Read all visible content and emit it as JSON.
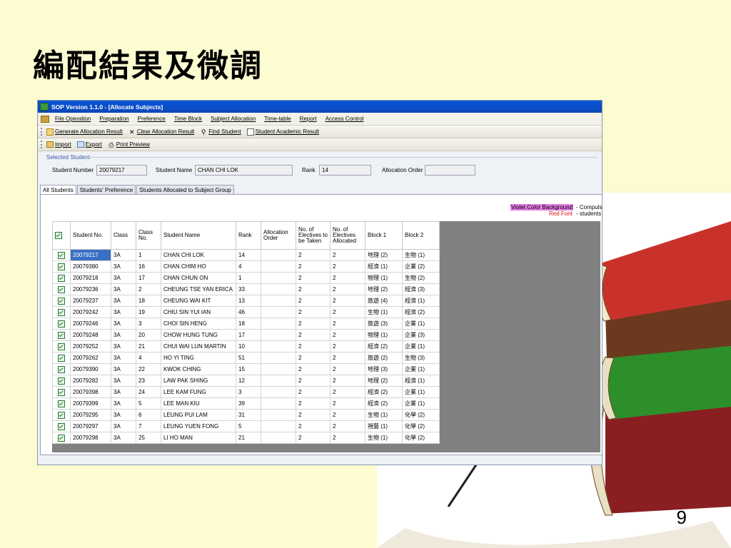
{
  "slide": {
    "title": "編配結果及微調",
    "page_number": "9"
  },
  "window": {
    "title": "SOP Version 1.1.0 - [Allocate Subjects]"
  },
  "menu": [
    "File Operation",
    "Preparation",
    "Preference",
    "Time Block",
    "Subject Allocation",
    "Time-table",
    "Report",
    "Access Control"
  ],
  "toolbar1": {
    "generate": "Generate Allocation Result",
    "clear": "Clear Allocation Result",
    "find": "Find Student",
    "academic": "Student Academic Result"
  },
  "toolbar2": {
    "import": "Import",
    "export": "Export",
    "print": "Print Preview"
  },
  "selected_student": {
    "legend": "Selected Student",
    "student_number_label": "Student Number",
    "student_number": "20079217",
    "student_name_label": "Student Name",
    "student_name": "CHAN CHI LOK",
    "rank_label": "Rank",
    "rank": "14",
    "allocation_order_label": "Allocation Order",
    "allocation_order": ""
  },
  "tabs": [
    "All Students",
    "Students' Preference",
    "Students Allocated to Subject Group"
  ],
  "legend": {
    "violet": "Violet Color Background",
    "violet_desc": "- Compulso",
    "red": "Red Font",
    "red_desc": "- students w"
  },
  "columns": [
    "Student No.",
    "Class",
    "Class No.",
    "Student Name",
    "Rank",
    "Allocation Order",
    "No. of Electives to be Taken",
    "No. of Electives Allocated",
    "Block 1",
    "Block 2"
  ],
  "rows": [
    {
      "no": "20079217",
      "cls": "3A",
      "cno": "1",
      "name": "CHAN CHI LOK",
      "rank": "14",
      "order": "",
      "taken": "2",
      "alloc": "2",
      "b1": "地理 (2)",
      "b2": "生物 (1)"
    },
    {
      "no": "20079380",
      "cls": "3A",
      "cno": "16",
      "name": "CHAN CHIM HO",
      "rank": "4",
      "order": "",
      "taken": "2",
      "alloc": "2",
      "b1": "經濟 (1)",
      "b2": "企業 (2)"
    },
    {
      "no": "20079218",
      "cls": "3A",
      "cno": "17",
      "name": "CHAN CHUN ON",
      "rank": "1",
      "order": "",
      "taken": "2",
      "alloc": "2",
      "b1": "物理 (1)",
      "b2": "生物 (2)"
    },
    {
      "no": "20079236",
      "cls": "3A",
      "cno": "2",
      "name": "CHEUNG TSE YAN ERICA",
      "rank": "33",
      "order": "",
      "taken": "2",
      "alloc": "2",
      "b1": "地理 (2)",
      "b2": "經濟 (3)"
    },
    {
      "no": "20079237",
      "cls": "3A",
      "cno": "18",
      "name": "CHEUNG WAI KIT",
      "rank": "13",
      "order": "",
      "taken": "2",
      "alloc": "2",
      "b1": "旅遊 (4)",
      "b2": "經濟 (1)"
    },
    {
      "no": "20079242",
      "cls": "3A",
      "cno": "19",
      "name": "CHIU SIN YUI IAN",
      "rank": "46",
      "order": "",
      "taken": "2",
      "alloc": "2",
      "b1": "生物 (1)",
      "b2": "經濟 (2)"
    },
    {
      "no": "20079246",
      "cls": "3A",
      "cno": "3",
      "name": "CHOI SIN HENG",
      "rank": "18",
      "order": "",
      "taken": "2",
      "alloc": "2",
      "b1": "旅遊 (3)",
      "b2": "企業 (1)"
    },
    {
      "no": "20079248",
      "cls": "3A",
      "cno": "20",
      "name": "CHOW HUNG TUNG",
      "rank": "17",
      "order": "",
      "taken": "2",
      "alloc": "2",
      "b1": "物理 (1)",
      "b2": "企業 (3)"
    },
    {
      "no": "20079252",
      "cls": "3A",
      "cno": "21",
      "name": "CHUI WAI LUN MARTIN",
      "rank": "10",
      "order": "",
      "taken": "2",
      "alloc": "2",
      "b1": "經濟 (2)",
      "b2": "企業 (1)"
    },
    {
      "no": "20079262",
      "cls": "3A",
      "cno": "4",
      "name": "HO YI TING",
      "rank": "51",
      "order": "",
      "taken": "2",
      "alloc": "2",
      "b1": "旅遊 (2)",
      "b2": "生物 (3)"
    },
    {
      "no": "20079390",
      "cls": "3A",
      "cno": "22",
      "name": "KWOK CHING",
      "rank": "15",
      "order": "",
      "taken": "2",
      "alloc": "2",
      "b1": "地理 (3)",
      "b2": "企業 (1)"
    },
    {
      "no": "20079282",
      "cls": "3A",
      "cno": "23",
      "name": "LAW PAK SHING",
      "rank": "12",
      "order": "",
      "taken": "2",
      "alloc": "2",
      "b1": "地理 (2)",
      "b2": "經濟 (1)"
    },
    {
      "no": "20079398",
      "cls": "3A",
      "cno": "24",
      "name": "LEE KAM FUNG",
      "rank": "3",
      "order": "",
      "taken": "2",
      "alloc": "2",
      "b1": "經濟 (2)",
      "b2": "企業 (1)"
    },
    {
      "no": "20079399",
      "cls": "3A",
      "cno": "5",
      "name": "LEE MAN KIU",
      "rank": "39",
      "order": "",
      "taken": "2",
      "alloc": "2",
      "b1": "經濟 (2)",
      "b2": "企業 (1)"
    },
    {
      "no": "20079295",
      "cls": "3A",
      "cno": "6",
      "name": "LEUNG PUI LAM",
      "rank": "31",
      "order": "",
      "taken": "2",
      "alloc": "2",
      "b1": "生物 (1)",
      "b2": "化學 (2)"
    },
    {
      "no": "20079297",
      "cls": "3A",
      "cno": "7",
      "name": "LEUNG YUEN FONG",
      "rank": "5",
      "order": "",
      "taken": "2",
      "alloc": "2",
      "b1": "視藝 (1)",
      "b2": "化學 (2)"
    },
    {
      "no": "20079298",
      "cls": "3A",
      "cno": "25",
      "name": "LI HO MAN",
      "rank": "21",
      "order": "",
      "taken": "2",
      "alloc": "2",
      "b1": "生物 (1)",
      "b2": "化學 (2)"
    }
  ]
}
